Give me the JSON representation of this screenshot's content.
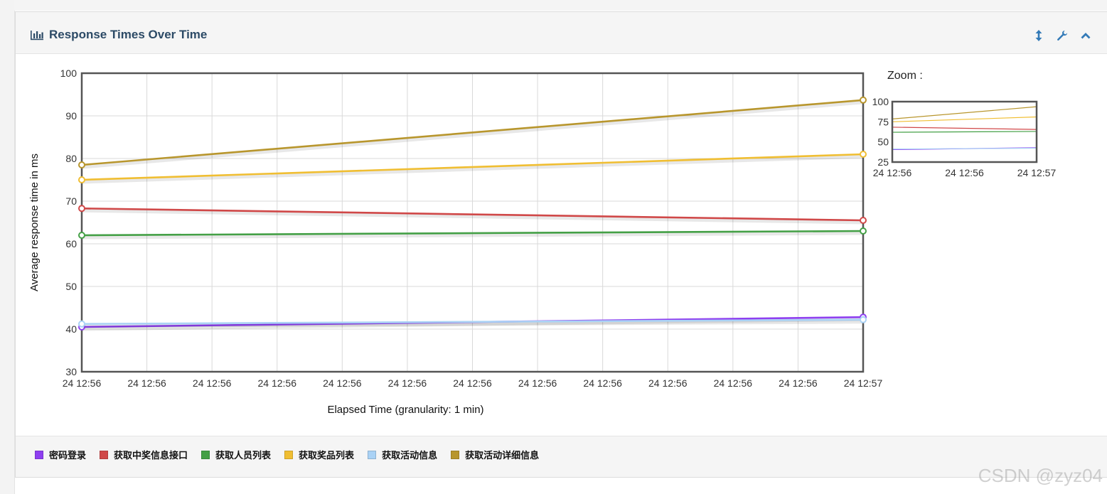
{
  "panel": {
    "title": "Response Times Over Time",
    "title_icon": "bar-chart-icon",
    "tools": [
      {
        "name": "resize-icon"
      },
      {
        "name": "wrench-icon"
      },
      {
        "name": "collapse-icon"
      }
    ]
  },
  "zoom": {
    "label": "Zoom :"
  },
  "watermark": "CSDN @zyz04",
  "chart_data": {
    "type": "line",
    "xlabel": "Elapsed Time (granularity: 1 min)",
    "ylabel": "Average response time in ms",
    "ylim": [
      30,
      100
    ],
    "yticks": [
      30,
      40,
      50,
      60,
      70,
      80,
      90,
      100
    ],
    "xtick_labels": [
      "24 12:56",
      "24 12:56",
      "24 12:56",
      "24 12:56",
      "24 12:56",
      "24 12:56",
      "24 12:56",
      "24 12:56",
      "24 12:56",
      "24 12:56",
      "24 12:56",
      "24 12:56",
      "24 12:57"
    ],
    "x": [
      0,
      1
    ],
    "grid": true,
    "series": [
      {
        "name": "密码登录",
        "color": "#8e3ff0",
        "values": [
          40.5,
          42.8
        ]
      },
      {
        "name": "获取中奖信息接口",
        "color": "#d04848",
        "values": [
          68.3,
          65.5
        ]
      },
      {
        "name": "获取人员列表",
        "color": "#44a046",
        "values": [
          62.0,
          63.0
        ]
      },
      {
        "name": "获取奖品列表",
        "color": "#f0be32",
        "values": [
          75.0,
          81.0
        ]
      },
      {
        "name": "获取活动信息",
        "color": "#aad2f5",
        "values": [
          41.2,
          42.2
        ]
      },
      {
        "name": "获取活动详细信息",
        "color": "#b8962d",
        "values": [
          78.5,
          93.7
        ]
      }
    ],
    "zoom_overview": {
      "yticks": [
        25,
        50,
        75,
        100
      ],
      "ylim": [
        25,
        100
      ],
      "xtick_labels": [
        "24 12:56",
        "24 12:56",
        "24 12:57"
      ]
    }
  }
}
